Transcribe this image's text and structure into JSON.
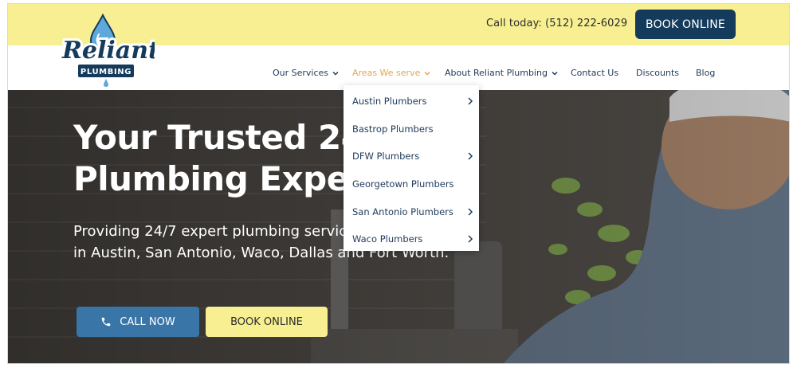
{
  "topbar": {
    "call_text": "Call today: (512) 222-6029",
    "book_label": "BOOK ONLINE"
  },
  "logo": {
    "line1": "Reliant",
    "line2": "PLUMBING"
  },
  "nav": {
    "items": [
      {
        "label": "Our Services",
        "has_menu": true
      },
      {
        "label": "Areas We serve",
        "has_menu": true,
        "active": true
      },
      {
        "label": "About Reliant Plumbing",
        "has_menu": true
      },
      {
        "label": "Contact Us",
        "has_menu": false
      },
      {
        "label": "Discounts",
        "has_menu": false
      },
      {
        "label": "Blog",
        "has_menu": false
      }
    ]
  },
  "dropdown": {
    "items": [
      {
        "label": "Austin Plumbers",
        "submenu": true
      },
      {
        "label": "Bastrop Plumbers",
        "submenu": false
      },
      {
        "label": "DFW Plumbers",
        "submenu": true
      },
      {
        "label": "Georgetown Plumbers",
        "submenu": false
      },
      {
        "label": "San Antonio Plumbers",
        "submenu": true
      },
      {
        "label": "Waco Plumbers",
        "submenu": true
      }
    ]
  },
  "hero": {
    "title_line1": "Your Trusted 24/7",
    "title_line2": "Plumbing Experts",
    "subtitle": "Providing 24/7 expert plumbing services to communities in Austin, San Antonio, Waco, Dallas and Fort Worth.",
    "call_label": "CALL NOW",
    "book_label": "BOOK ONLINE"
  },
  "colors": {
    "brand_navy": "#143b5c",
    "brand_yellow": "#f7ef91",
    "accent_blue": "#3a75a8",
    "nav_active": "#e1a84a"
  },
  "icons": {
    "call_button": "phone-icon",
    "menu": "chevron-down-icon",
    "submenu": "chevron-right-icon"
  }
}
